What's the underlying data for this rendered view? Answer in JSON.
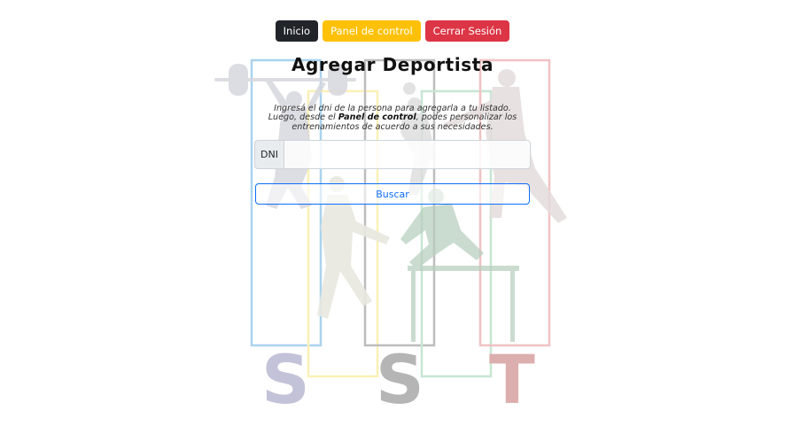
{
  "nav": {
    "home_label": "Inicio",
    "panel_label": "Panel de control",
    "logout_label": "Cerrar Sesión"
  },
  "page": {
    "title": "Agregar Deportista",
    "desc_part1": "Ingresá el dni de la persona para agregarla a tu listado. Luego, desde el ",
    "desc_bold": "Panel de control",
    "desc_part2": ", podes personalizar los entrenamientos de acuerdo a sus necesidades."
  },
  "form": {
    "dni_label": "DNI",
    "dni_value": "",
    "search_label": "Buscar"
  },
  "colors": {
    "dark": "#212529",
    "warning": "#ffc107",
    "danger": "#dc3545",
    "primary": "#0d6efd"
  },
  "background_icons": [
    "weightlifter-silhouette",
    "runner-silhouette",
    "volleyball-silhouette",
    "tennis-silhouette",
    "hurdler-silhouette"
  ]
}
